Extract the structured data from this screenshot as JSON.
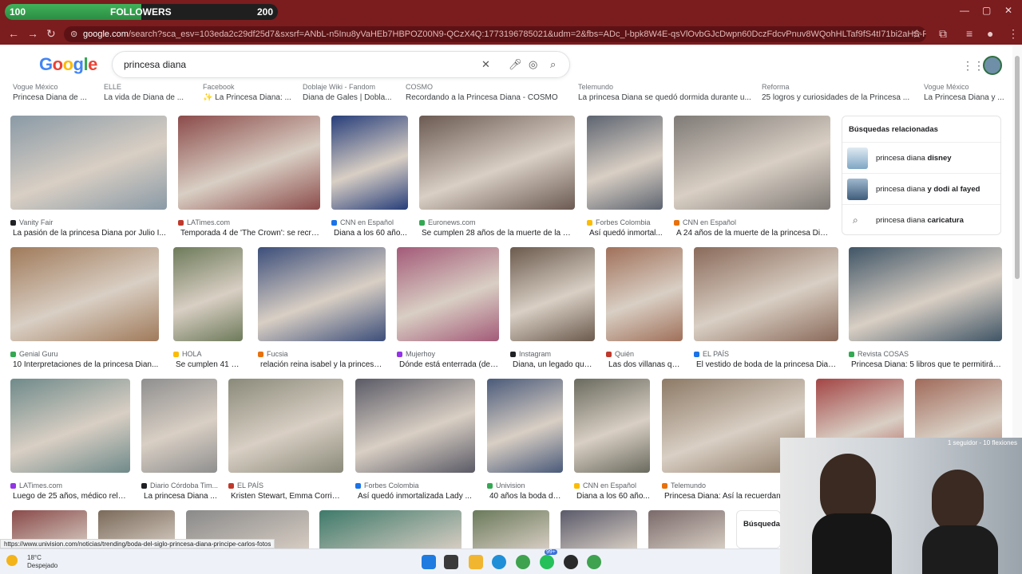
{
  "overlay": {
    "followers_label": "FOLLOWERS",
    "start": "100",
    "goal": "200",
    "progress": 0.5
  },
  "browser": {
    "url_domain": "google.com",
    "url_rest": "/search?sca_esv=103eda2c29df25d7&sxsrf=ANbL-n5Inu8yVaHEb7HBPOZ00N9-QCzX4Q:1773196785021&udm=2&fbs=ADc_l-bpk8W4E-qsVlOvbGJcDwpn60DczFdcvPnuv8WQohHLTaf9fS4tI71bi2aHS-Pmeg2QNsLCUqzZKqmjKDQ4UhxYz..."
  },
  "google": {
    "logo": "Google",
    "query": "princesa diana"
  },
  "top_strip": [
    {
      "src": "Vogue México",
      "cap": "Princesa Diana de ..."
    },
    {
      "src": "ELLE",
      "cap": "La vida de Diana de ..."
    },
    {
      "src": "Facebook",
      "cap": "✨ La Princesa Diana: ..."
    },
    {
      "src": "Doblaje Wiki - Fandom",
      "cap": "Diana de Gales | Dobla..."
    },
    {
      "src": "COSMO",
      "cap": "Recordando a la Princesa Diana - COSMO"
    },
    {
      "src": "Telemundo",
      "cap": "La princesa Diana se quedó dormida durante u..."
    },
    {
      "src": "Reforma",
      "cap": "25 logros y curiosidades de la Princesa ..."
    },
    {
      "src": "Vogue México",
      "cap": "La Princesa Diana y ..."
    }
  ],
  "rows": [
    [
      {
        "src": "Vanity Fair",
        "cap": "La pasión de la princesa Diana por Julio I...",
        "c": "#8a9aa6"
      },
      {
        "src": "LATimes.com",
        "cap": "Temporada 4 de 'The Crown': se recre...",
        "c": "#8b4b4a"
      },
      {
        "src": "CNN en Español",
        "cap": "Diana a los 60 año...",
        "c": "#273e7a"
      },
      {
        "src": "Euronews.com",
        "cap": "Se cumplen 28 años de la muerte de la pri...",
        "c": "#6b5a52"
      },
      {
        "src": "Forbes Colombia",
        "cap": "Así quedó inmortal...",
        "c": "#5d6470"
      },
      {
        "src": "CNN en Español",
        "cap": "A 24 años de la muerte de la princesa Dia...",
        "c": "#7f7a76"
      }
    ],
    [
      {
        "src": "Genial Guru",
        "cap": "10 Interpretaciones de la princesa Dian...",
        "c": "#a07a5a"
      },
      {
        "src": "HOLA",
        "cap": "Se cumplen 41 añ...",
        "c": "#6d7a5a"
      },
      {
        "src": "Fucsia",
        "cap": "relación reina isabel y la princesa ...",
        "c": "#3c4e7a"
      },
      {
        "src": "Mujerhoy",
        "cap": "Dónde está enterrada (de ...",
        "c": "#a35a78"
      },
      {
        "src": "Instagram",
        "cap": "Diana, un legado que...",
        "c": "#6b5a4d"
      },
      {
        "src": "Quién",
        "cap": "Las dos villanas qu...",
        "c": "#a0705a"
      },
      {
        "src": "EL PAÍS",
        "cap": "El vestido de boda de la princesa Dian...",
        "c": "#8a6a5a"
      },
      {
        "src": "Revista COSAS",
        "cap": "Princesa Diana: 5 libros que te permitirán...",
        "c": "#405566"
      }
    ],
    [
      {
        "src": "LATimes.com",
        "cap": "Luego de 25 años, médico relat...",
        "c": "#6f8a8a"
      },
      {
        "src": "Diario Córdoba Tim...",
        "cap": "La princesa Diana ...",
        "c": "#8f8f8f"
      },
      {
        "src": "EL PAÍS",
        "cap": "Kristen Stewart, Emma Corrin, ...",
        "c": "#8a8a7a"
      },
      {
        "src": "Forbes Colombia",
        "cap": "Así quedó inmortalizada Lady ...",
        "c": "#5a5a66"
      },
      {
        "src": "Univision",
        "cap": "40 años la boda de...",
        "c": "#4a5a7a"
      },
      {
        "src": "CNN en Español",
        "cap": "Diana a los 60 año...",
        "c": "#6a6a5e"
      },
      {
        "src": "Telemundo",
        "cap": "Princesa Diana: Así la recuerdan, ...",
        "c": "#8d7a66"
      },
      {
        "src": "",
        "cap": "",
        "c": "#a34545"
      },
      {
        "src": "",
        "cap": "",
        "c": "#a06a5a"
      }
    ]
  ],
  "related": {
    "title": "Búsquedas relacionadas",
    "items": [
      {
        "pre": "princesa diana",
        "bold": "disney"
      },
      {
        "pre": "princesa diana",
        "bold": "y dodi al fayed"
      },
      {
        "pre": "princesa diana",
        "bold": "caricatura"
      }
    ]
  },
  "bottom_related": "Búsqueda",
  "status_url": "https://www.univision.com/noticias/trending/boda-del-siglo-princesa-diana-principe-carlos-fotos",
  "webcam_note": "1 seguidor - 10 flexiones",
  "taskbar": {
    "temp": "18°C",
    "weather": "Despejado",
    "badge": "99+"
  }
}
